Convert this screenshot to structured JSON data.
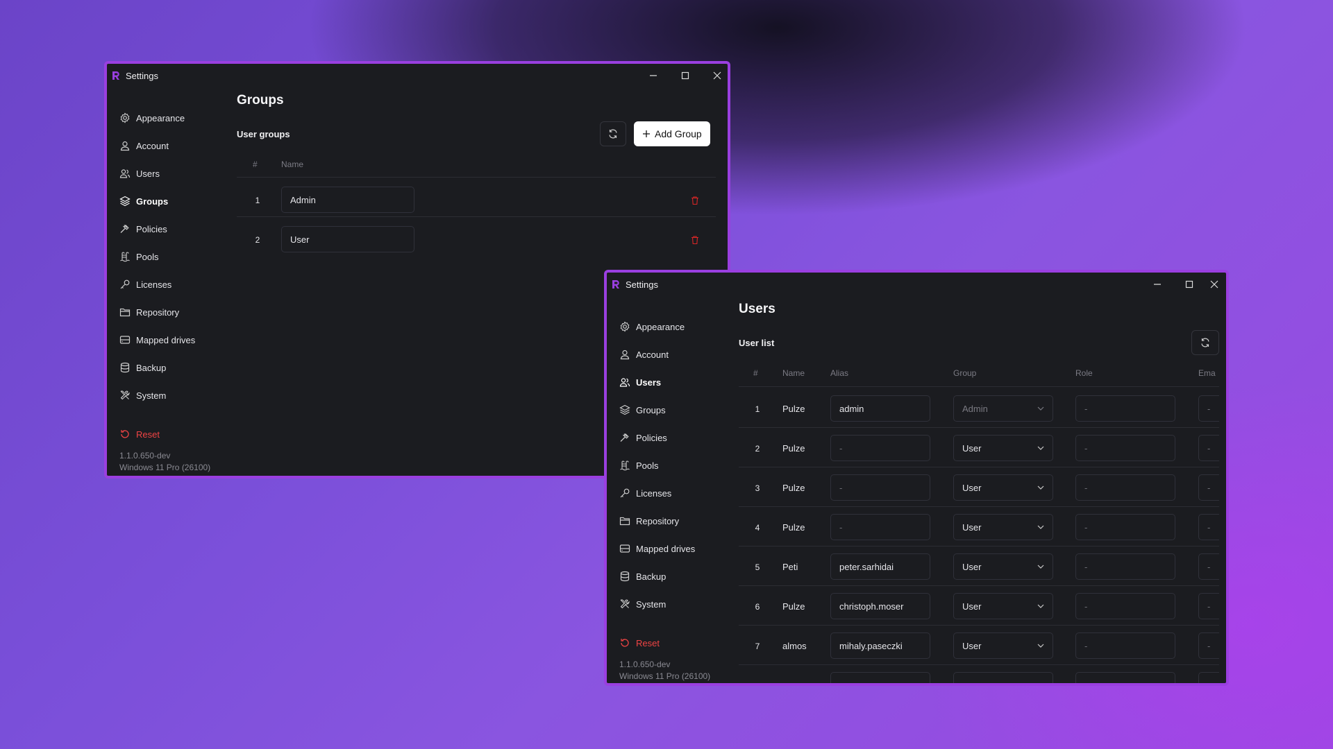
{
  "colors": {
    "accent": "#9a3fe0",
    "window_bg": "#1b1c20",
    "danger": "#ef4444"
  },
  "groups_window": {
    "title": "Settings",
    "sidebar": {
      "items": [
        {
          "label": "Appearance",
          "icon": "gear-icon"
        },
        {
          "label": "Account",
          "icon": "user-icon"
        },
        {
          "label": "Users",
          "icon": "users-icon"
        },
        {
          "label": "Groups",
          "icon": "layers-icon",
          "active": true
        },
        {
          "label": "Policies",
          "icon": "gavel-icon"
        },
        {
          "label": "Pools",
          "icon": "pool-icon"
        },
        {
          "label": "Licenses",
          "icon": "key-icon"
        },
        {
          "label": "Repository",
          "icon": "folder-icon"
        },
        {
          "label": "Mapped drives",
          "icon": "drive-icon"
        },
        {
          "label": "Backup",
          "icon": "database-icon"
        },
        {
          "label": "System",
          "icon": "tools-icon"
        }
      ],
      "reset_label": "Reset",
      "version": "1.1.0.650-dev",
      "os": "Windows 11 Pro (26100)"
    },
    "page_title": "Groups",
    "section_label": "User groups",
    "add_button_label": "Add Group",
    "table": {
      "headers": [
        "#",
        "Name"
      ],
      "rows": [
        {
          "num": "1",
          "name": "Admin"
        },
        {
          "num": "2",
          "name": "User"
        }
      ]
    }
  },
  "users_window": {
    "title": "Settings",
    "sidebar": {
      "items": [
        {
          "label": "Appearance",
          "icon": "gear-icon"
        },
        {
          "label": "Account",
          "icon": "user-icon"
        },
        {
          "label": "Users",
          "icon": "users-icon",
          "active": true
        },
        {
          "label": "Groups",
          "icon": "layers-icon"
        },
        {
          "label": "Policies",
          "icon": "gavel-icon"
        },
        {
          "label": "Pools",
          "icon": "pool-icon"
        },
        {
          "label": "Licenses",
          "icon": "key-icon"
        },
        {
          "label": "Repository",
          "icon": "folder-icon"
        },
        {
          "label": "Mapped drives",
          "icon": "drive-icon"
        },
        {
          "label": "Backup",
          "icon": "database-icon"
        },
        {
          "label": "System",
          "icon": "tools-icon"
        }
      ],
      "reset_label": "Reset",
      "version": "1.1.0.650-dev",
      "os": "Windows 11 Pro (26100)"
    },
    "page_title": "Users",
    "section_label": "User list",
    "table": {
      "headers": [
        "#",
        "Name",
        "Alias",
        "Group",
        "Role",
        "Ema"
      ],
      "rows": [
        {
          "num": "1",
          "name": "Pulze",
          "alias": "admin",
          "group": "Admin",
          "role": "-",
          "email": "-"
        },
        {
          "num": "2",
          "name": "Pulze",
          "alias": "-",
          "group": "User",
          "role": "-",
          "email": "-"
        },
        {
          "num": "3",
          "name": "Pulze",
          "alias": "-",
          "group": "User",
          "role": "-",
          "email": "-"
        },
        {
          "num": "4",
          "name": "Pulze",
          "alias": "-",
          "group": "User",
          "role": "-",
          "email": "-"
        },
        {
          "num": "5",
          "name": "Peti",
          "alias": "peter.sarhidai",
          "group": "User",
          "role": "-",
          "email": "-"
        },
        {
          "num": "6",
          "name": "Pulze",
          "alias": "christoph.moser",
          "group": "User",
          "role": "-",
          "email": "-"
        },
        {
          "num": "7",
          "name": "almos",
          "alias": "mihaly.paseczki",
          "group": "User",
          "role": "-",
          "email": "-"
        }
      ]
    }
  }
}
